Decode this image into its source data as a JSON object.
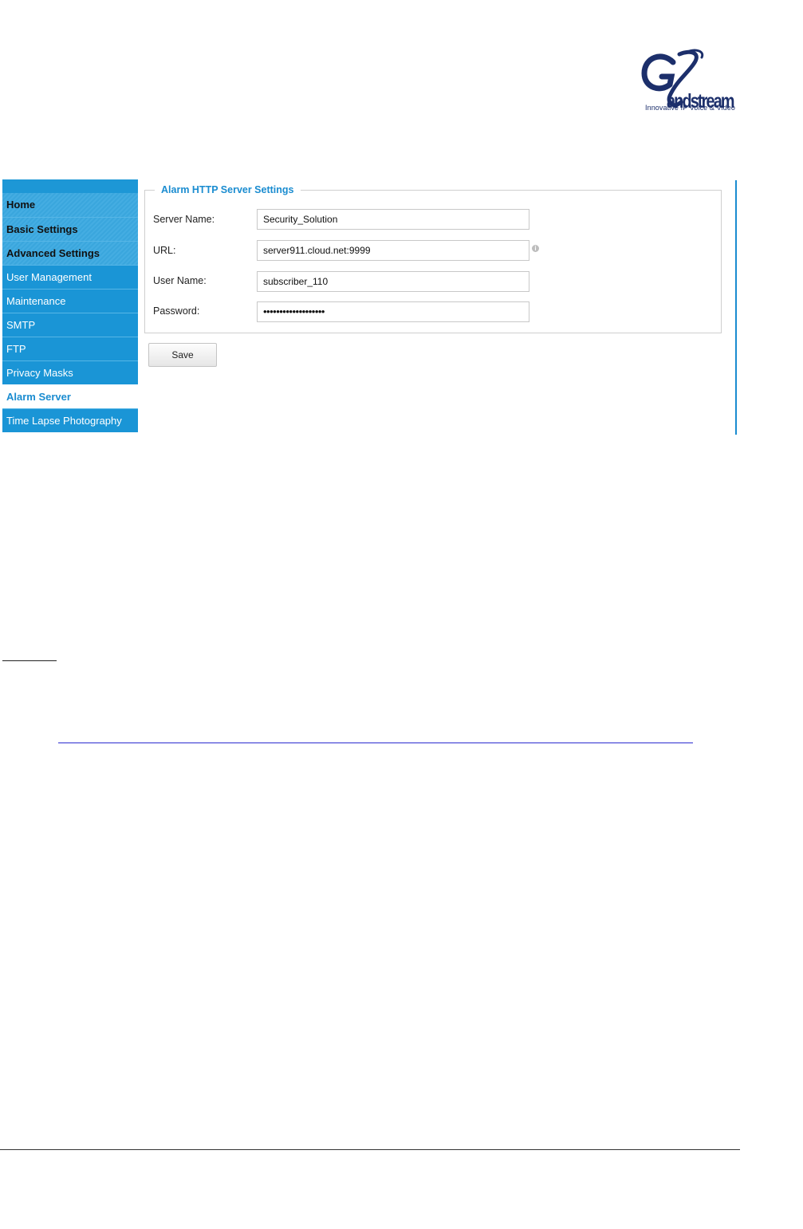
{
  "logo": {
    "tagline": "Innovative IP Voice & Video",
    "brand_color": "#1c2f6b"
  },
  "sidebar": {
    "items": [
      {
        "label": "Home",
        "type": "header"
      },
      {
        "label": "Basic Settings",
        "type": "header"
      },
      {
        "label": "Advanced Settings",
        "type": "header"
      },
      {
        "label": "User Management",
        "type": "item"
      },
      {
        "label": "Maintenance",
        "type": "item"
      },
      {
        "label": "SMTP",
        "type": "item"
      },
      {
        "label": "FTP",
        "type": "item"
      },
      {
        "label": "Privacy Masks",
        "type": "item"
      },
      {
        "label": "Alarm Server",
        "type": "active"
      },
      {
        "label": "Time Lapse Photography",
        "type": "item"
      }
    ],
    "accent_color": "#1a95d6"
  },
  "form": {
    "legend": "Alarm HTTP Server Settings",
    "server_name": {
      "label": "Server Name:",
      "value": "Security_Solution"
    },
    "url": {
      "label": "URL:",
      "value": "server911.cloud.net:9999"
    },
    "user_name": {
      "label": "User Name:",
      "value": "subscriber_110"
    },
    "password": {
      "label": "Password:",
      "value": "•••••••••••••••••••"
    },
    "save_label": "Save"
  },
  "icons": {
    "url_info": "info-icon"
  }
}
